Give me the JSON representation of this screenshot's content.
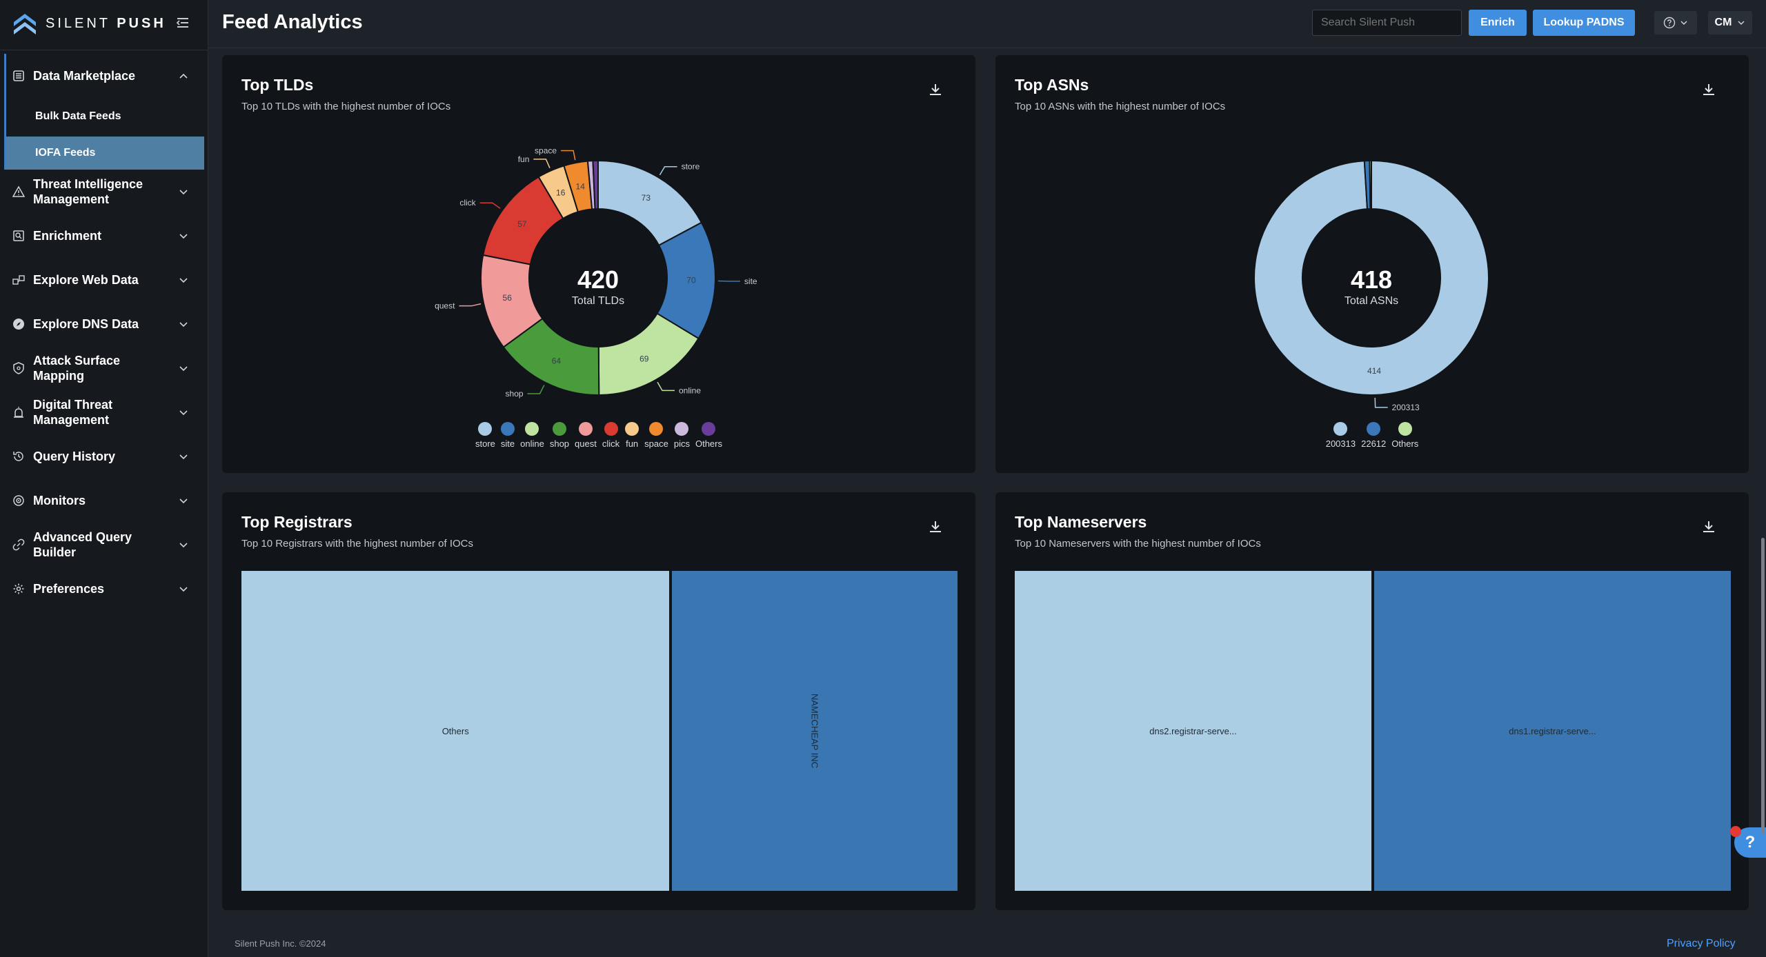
{
  "brand": {
    "name_light": "SILENT ",
    "name_bold": "PUSH"
  },
  "header": {
    "title": "Feed Analytics",
    "search_placeholder": "Search Silent Push",
    "enrich_label": "Enrich",
    "lookup_label": "Lookup PADNS",
    "user_initials": "CM"
  },
  "sidebar": {
    "items": [
      {
        "label": "Data Marketplace",
        "icon": "database-icon",
        "expanded": true,
        "children": [
          {
            "label": "Bulk Data Feeds"
          },
          {
            "label": "IOFA Feeds",
            "active": true
          }
        ]
      },
      {
        "label": "Threat Intelligence Management",
        "icon": "warning-icon"
      },
      {
        "label": "Enrichment",
        "icon": "enrichment-icon"
      },
      {
        "label": "Explore Web Data",
        "icon": "web-data-icon"
      },
      {
        "label": "Explore DNS Data",
        "icon": "compass-icon"
      },
      {
        "label": "Attack Surface Mapping",
        "icon": "shield-icon"
      },
      {
        "label": "Digital Threat Management",
        "icon": "alarm-icon"
      },
      {
        "label": "Query History",
        "icon": "history-icon"
      },
      {
        "label": "Monitors",
        "icon": "monitor-icon"
      },
      {
        "label": "Advanced Query Builder",
        "icon": "link-icon"
      },
      {
        "label": "Preferences",
        "icon": "gear-icon"
      }
    ]
  },
  "cards": {
    "tlds": {
      "title": "Top TLDs",
      "subtitle": "Top 10 TLDs with the highest number of IOCs",
      "total": "420",
      "total_label": "Total TLDs"
    },
    "asns": {
      "title": "Top ASNs",
      "subtitle": "Top 10 ASNs with the highest number of IOCs",
      "total": "418",
      "total_label": "Total ASNs"
    },
    "registrars": {
      "title": "Top Registrars",
      "subtitle": "Top 10 Registrars with the highest number of IOCs"
    },
    "nameservers": {
      "title": "Top Nameservers",
      "subtitle": "Top 10 Nameservers with the highest number of IOCs"
    }
  },
  "chart_data": [
    {
      "type": "pie",
      "title": "Top TLDs",
      "categories": [
        "store",
        "site",
        "online",
        "shop",
        "quest",
        "click",
        "fun",
        "space",
        "pics",
        "Others"
      ],
      "values": [
        73,
        70,
        69,
        64,
        56,
        57,
        16,
        14,
        3,
        3
      ],
      "value_labels": [
        "73",
        "70",
        "69",
        "64",
        "56",
        "57",
        "16",
        "14",
        "",
        ""
      ],
      "outer_labels": [
        "store",
        "site",
        "online",
        "shop",
        "quest",
        "click",
        "fun",
        "space",
        "",
        ""
      ],
      "colors": [
        "#a9cbe6",
        "#3a78b9",
        "#bfe3a1",
        "#4a9b3c",
        "#f09a9a",
        "#d93a32",
        "#f7c98a",
        "#f08a2e",
        "#cdb8dd",
        "#6a3d9a"
      ],
      "legend_placement": "bottom"
    },
    {
      "type": "pie",
      "title": "Top ASNs",
      "categories": [
        "200313",
        "22612",
        "Others"
      ],
      "values": [
        414,
        3,
        1
      ],
      "value_labels": [
        "414",
        "",
        ""
      ],
      "outer_labels": [
        "200313",
        "",
        ""
      ],
      "colors": [
        "#a9cbe6",
        "#3a78b9",
        "#bfe3a1"
      ],
      "legend_placement": "bottom"
    },
    {
      "type": "treemap",
      "title": "Top Registrars",
      "categories": [
        "Others",
        "NAMECHEAP INC"
      ],
      "values": [
        60,
        40
      ],
      "colors": [
        "#abcee4",
        "#3a76b1"
      ]
    },
    {
      "type": "treemap",
      "title": "Top Nameservers",
      "categories": [
        "dns2.registrar-serve...",
        "dns1.registrar-serve..."
      ],
      "values": [
        50,
        50
      ],
      "colors": [
        "#abcee4",
        "#3a76b1"
      ]
    }
  ],
  "footer": {
    "copyright": "Silent Push Inc. ©2024",
    "privacy": "Privacy Policy"
  },
  "help_fab": "?"
}
